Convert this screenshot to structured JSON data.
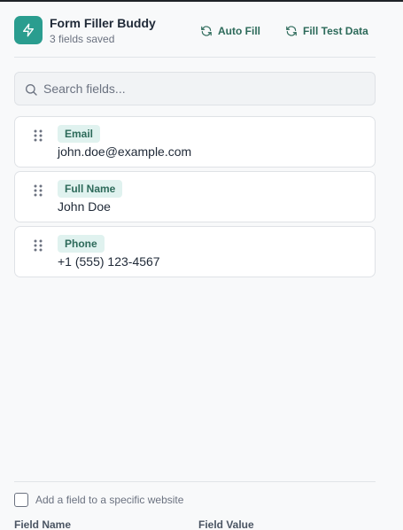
{
  "app": {
    "title": "Form Filler Buddy",
    "subtitle": "3 fields saved"
  },
  "header_actions": {
    "auto_fill_label": "Auto Fill",
    "fill_test_data_label": "Fill Test Data"
  },
  "search": {
    "placeholder": "Search fields...",
    "value": ""
  },
  "fields": [
    {
      "name": "Email",
      "value": "john.doe@example.com"
    },
    {
      "name": "Full Name",
      "value": "John Doe"
    },
    {
      "name": "Phone",
      "value": "+1 (555) 123-4567"
    }
  ],
  "add_field": {
    "specific_site_label": "Add a field to a specific website",
    "specific_site_checked": false,
    "field_name_label": "Field Name",
    "field_value_label": "Field Value"
  },
  "icons": {
    "logo": "lightning-bolt-icon",
    "auto_fill": "refresh-icon",
    "fill_test_data": "refresh-icon",
    "search": "search-icon",
    "drag": "drag-handle-icon"
  },
  "colors": {
    "accent": "#2a9d8f",
    "accent_text": "#2d6a5a",
    "tag_background": "#e0f2ef",
    "page_background": "#f8f9fa"
  }
}
